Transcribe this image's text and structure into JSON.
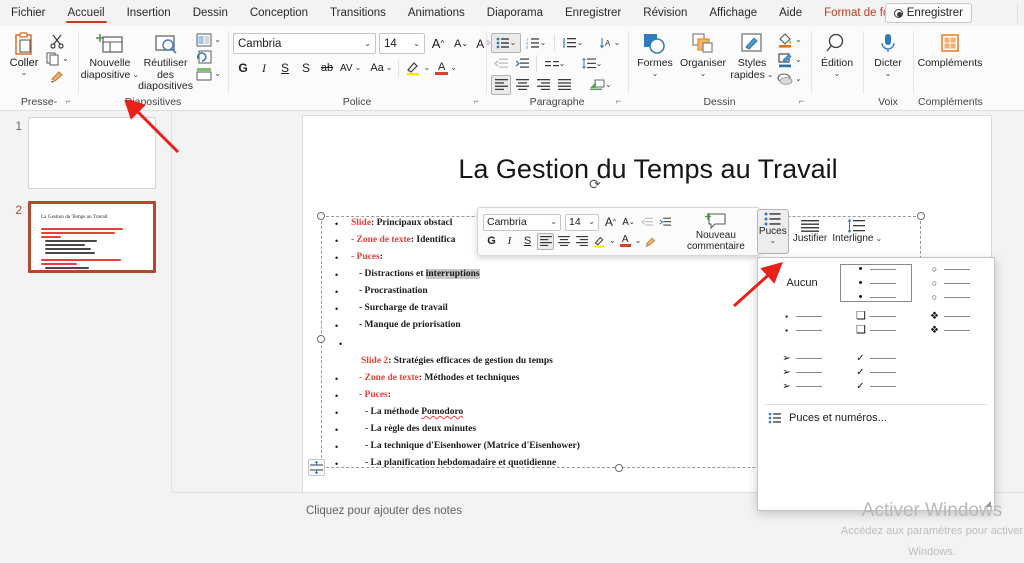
{
  "tabs": [
    {
      "label": "Fichier",
      "state": "normal"
    },
    {
      "label": "Accueil",
      "state": "active"
    },
    {
      "label": "Insertion",
      "state": "normal"
    },
    {
      "label": "Dessin",
      "state": "normal"
    },
    {
      "label": "Conception",
      "state": "normal"
    },
    {
      "label": "Transitions",
      "state": "normal"
    },
    {
      "label": "Animations",
      "state": "normal"
    },
    {
      "label": "Diaporama",
      "state": "normal"
    },
    {
      "label": "Enregistrer",
      "state": "normal"
    },
    {
      "label": "Révision",
      "state": "normal"
    },
    {
      "label": "Affichage",
      "state": "normal"
    },
    {
      "label": "Aide",
      "state": "normal"
    },
    {
      "label": "Format de forme",
      "state": "contextual"
    }
  ],
  "titlebar": {
    "save_label": "Enregistrer"
  },
  "ribbon": {
    "clipboard": {
      "group_label": "Presse-papiers",
      "paste_label": "Coller",
      "cut_name": "cut-icon",
      "copy_name": "copy-icon",
      "format_painter_name": "format-painter-icon"
    },
    "slides": {
      "group_label": "Diapositives",
      "new_slide_line1": "Nouvelle",
      "new_slide_line2": "diapositive",
      "reuse_line1": "Réutiliser des",
      "reuse_line2": "diapositives",
      "layout_name": "layout-icon",
      "reset_name": "reset-icon",
      "section_name": "section-icon"
    },
    "font": {
      "group_label": "Police",
      "font_name": "Cambria",
      "font_size": "14",
      "grow_label": "A",
      "shrink_label": "A",
      "clear_format_label": "A",
      "bold_label": "G",
      "italic_label": "I",
      "underline_label": "S",
      "shadow_label": "S",
      "strike_label": "ab",
      "spacing_label": "AV",
      "case_label": "Aa",
      "highlight_label": "A",
      "fontcolor_label": "A"
    },
    "paragraph": {
      "group_label": "Paragraphe",
      "bullets_name": "bullets-icon",
      "numbering_name": "numbering-icon",
      "list_level_name": "list-level-icon",
      "text_direction_name": "text-direction-icon",
      "decrease_indent_name": "decrease-indent-icon",
      "increase_indent_name": "increase-indent-icon",
      "columns_name": "columns-icon",
      "line_spacing_name": "line-spacing-icon",
      "align_left_name": "align-left-icon",
      "align_center_name": "align-center-icon",
      "align_right_name": "align-right-icon",
      "align_justify_name": "align-justify-icon",
      "smartart_name": "smartart-icon"
    },
    "drawing": {
      "group_label": "Dessin",
      "shapes_label": "Formes",
      "arrange_label": "Organiser",
      "quickstyles_line1": "Styles",
      "quickstyles_line2": "rapides",
      "shape_fill_name": "shape-fill-icon",
      "shape_outline_name": "shape-outline-icon",
      "shape_effects_name": "shape-effects-icon"
    },
    "editing": {
      "group_label": "",
      "label": "Édition"
    },
    "voice": {
      "group_label": "Voix",
      "label": "Dicter"
    },
    "addins": {
      "group_label": "Compléments",
      "label": "Compléments"
    }
  },
  "thumbnails": [
    {
      "number": "1",
      "selected": false,
      "title": ""
    },
    {
      "number": "2",
      "selected": true,
      "title": "La Gestion du Temps au Travail"
    }
  ],
  "slide": {
    "title": "La Gestion du Temps au Travail",
    "body": [
      {
        "prefix": "Slide",
        "prefix_color": "red",
        "text": ": Principaux obstacl",
        "indent": 0,
        "bullet": true
      },
      {
        "prefix": "- Zone de texte",
        "prefix_color": "red",
        "text": ": Identifica",
        "indent": 0,
        "bullet": true
      },
      {
        "prefix": "- Puces",
        "prefix_color": "red",
        "text": ":",
        "indent": 0,
        "bullet": true
      },
      {
        "prefix": "",
        "prefix_color": "none",
        "text": "- Distractions et ",
        "highlight": "interruptions",
        "indent": 1,
        "bullet": true
      },
      {
        "prefix": "",
        "prefix_color": "none",
        "text": "- Procrastination",
        "indent": 1,
        "bullet": true
      },
      {
        "prefix": "",
        "prefix_color": "none",
        "text": "- Surcharge de travail",
        "indent": 1,
        "bullet": true
      },
      {
        "prefix": "",
        "prefix_color": "none",
        "text": "- Manque de priorisation",
        "indent": 1,
        "bullet": true
      },
      {
        "prefix": "",
        "prefix_color": "none",
        "text": "",
        "indent": 0,
        "bullet": true
      },
      {
        "prefix": "Slide 2",
        "prefix_color": "red",
        "text": ": Stratégies efficaces de gestion du temps",
        "indent": 1,
        "bullet": false
      },
      {
        "prefix": "- Zone de texte",
        "prefix_color": "red",
        "text": ": Méthodes et techniques",
        "indent": 0,
        "bullet": true
      },
      {
        "prefix": "- Puces",
        "prefix_color": "red",
        "text": ":",
        "indent": 0,
        "bullet": true
      },
      {
        "prefix": "",
        "prefix_color": "none",
        "text": "- La méthode ",
        "spell": "Pomodoro",
        "indent": 1,
        "bullet": true
      },
      {
        "prefix": "",
        "prefix_color": "none",
        "text": "- La règle des deux minutes",
        "indent": 1,
        "bullet": true
      },
      {
        "prefix": "",
        "prefix_color": "none",
        "text": "- La technique d'Eisenhower (Matrice d'Eisenhower)",
        "indent": 1,
        "bullet": true
      },
      {
        "prefix": "",
        "prefix_color": "none",
        "text": "- La planification hebdomadaire et quotidienne",
        "indent": 1,
        "bullet": true
      }
    ]
  },
  "notes": {
    "placeholder": "Cliquez pour ajouter des notes"
  },
  "minibar": {
    "font_name": "Cambria",
    "font_size": "14",
    "grow_label": "A",
    "shrink_label": "A",
    "bold_label": "G",
    "italic_label": "I",
    "underline_label": "S",
    "comment_line1": "Nouveau",
    "comment_line2": "commentaire",
    "bullets_label": "Puces",
    "justify_label": "Justifier",
    "linespacing_label": "Interligne"
  },
  "bullet_gallery": {
    "none_label": "Aucun",
    "cells": [
      {
        "mark": "",
        "label": "Aucun",
        "kind": "none",
        "selected": false
      },
      {
        "mark": "•",
        "label": "",
        "kind": "filled-round",
        "selected": true
      },
      {
        "mark": "○",
        "label": "",
        "kind": "hollow-round",
        "selected": false
      },
      {
        "mark": "▪",
        "label": "",
        "kind": "filled-square-small",
        "selected": false
      },
      {
        "mark": "❑",
        "label": "",
        "kind": "hollow-square",
        "selected": false
      },
      {
        "mark": "❖",
        "label": "",
        "kind": "diamond",
        "selected": false
      },
      {
        "mark": "➢",
        "label": "",
        "kind": "arrow",
        "selected": false
      },
      {
        "mark": "✓",
        "label": "",
        "kind": "check",
        "selected": false
      }
    ],
    "footer_label": "Puces et numéros...",
    "footer_icon": "bullets-and-numbering-icon"
  },
  "watermark": {
    "line1": "Activer Windows",
    "line2": "Accédez aux paramètres pour activer Windows."
  },
  "colors": {
    "accent": "#c43e1c",
    "annotation_arrow": "#e8201a",
    "slide_red_text": "#e8413b",
    "selection_border": "#b7472a"
  }
}
